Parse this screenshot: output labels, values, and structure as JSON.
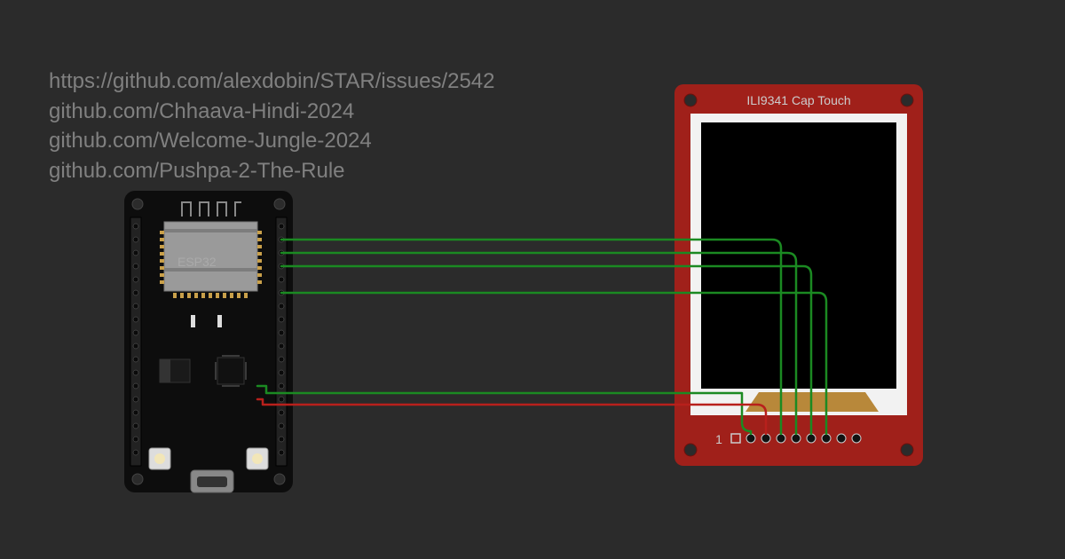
{
  "links": [
    "https://github.com/alexdobin/STAR/issues/2542",
    "github.com/Chhaava-Hindi-2024",
    "github.com/Welcome-Jungle-2024",
    "github.com/Pushpa-2-The-Rule"
  ],
  "esp32_label": "ESP32",
  "display_label": "ILI9341 Cap Touch",
  "pin_one_label": "1",
  "colors": {
    "bg": "#2b2b2b",
    "pcb_black": "#0d0d0d",
    "pcb_red": "#a0201a",
    "wire_green": "#1b8a22",
    "wire_red": "#b8201c",
    "metal": "#b8b8b8",
    "gold": "#c9a04a"
  }
}
